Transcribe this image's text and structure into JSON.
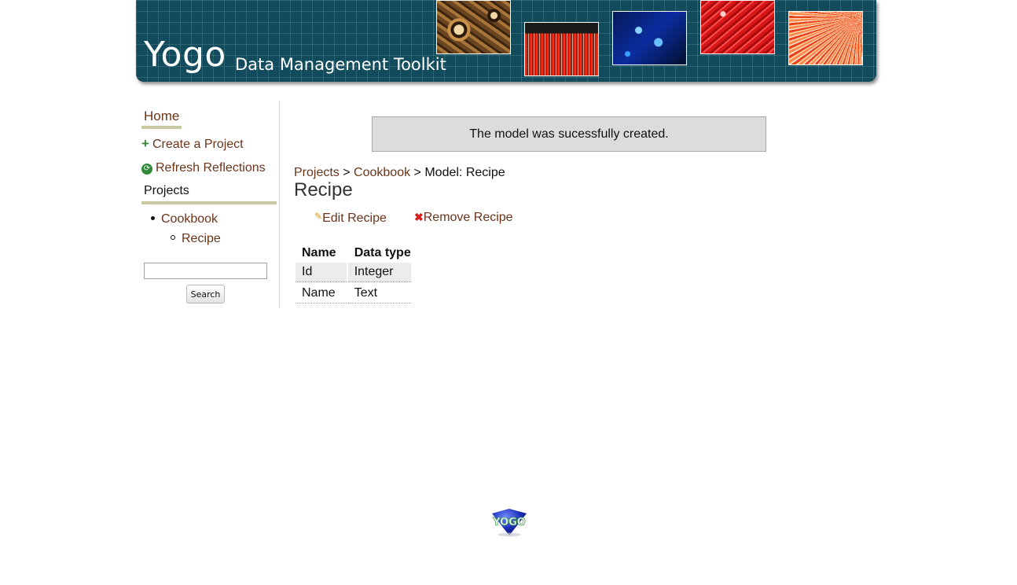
{
  "header": {
    "brand": "Yogo",
    "tagline": "Data Management Toolkit"
  },
  "sidebar": {
    "home": "Home",
    "create_project": "Create a Project",
    "refresh_reflections": "Refresh Reflections",
    "projects_heading": "Projects",
    "tree": {
      "project": "Cookbook",
      "model": "Recipe"
    },
    "search": {
      "value": "",
      "button": "Search"
    }
  },
  "main": {
    "flash": "The model was sucessfully created.",
    "breadcrumb": {
      "projects": "Projects",
      "project": "Cookbook",
      "sep": ">",
      "current": "Model: Recipe"
    },
    "title": "Recipe",
    "actions": {
      "edit": "Edit Recipe",
      "remove": "Remove Recipe"
    },
    "table": {
      "headers": [
        "Name",
        "Data type"
      ],
      "rows": [
        [
          "Id",
          "Integer"
        ],
        [
          "Name",
          "Text"
        ]
      ]
    }
  },
  "footer": {
    "logo_text": "YOGO"
  },
  "colors": {
    "banner": "#114b5c",
    "link": "#6a3419",
    "underline": "#c9caa0"
  }
}
